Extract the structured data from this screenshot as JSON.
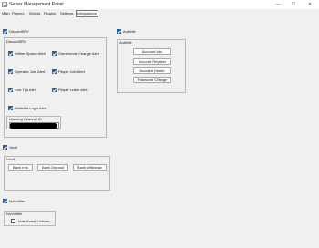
{
  "window": {
    "title": "Server Management Panel",
    "controls": {
      "minimize": "—",
      "maximize": "☐",
      "close": "✕"
    }
  },
  "menu": {
    "items": [
      "Main",
      "Players",
      "Worlds",
      "Plugins",
      "Settings",
      "Integrations"
    ],
    "active": "Integrations"
  },
  "discordsrv": {
    "enable_label": "DiscordSRV",
    "enabled": true,
    "group_title": "DiscordSRV",
    "options": [
      {
        "label": "Wither Spawn Alert",
        "checked": true
      },
      {
        "label": "Gamemode Change Alert",
        "checked": true
      },
      {
        "label": "Operator Join Alert",
        "checked": true
      },
      {
        "label": "Player Join Alert",
        "checked": true
      },
      {
        "label": "Low Tps Alert",
        "checked": true
      },
      {
        "label": "Player Leave Alert",
        "checked": true
      },
      {
        "label": "Whitelist Login Alert",
        "checked": true
      }
    ],
    "warning_channel_label": "Warning Channel ID"
  },
  "authme": {
    "enable_label": "AuthMe",
    "enabled": true,
    "group_title": "AuthMe",
    "buttons": [
      "Account Info",
      "Account Register",
      "Account Delete",
      "Password Change"
    ]
  },
  "vault": {
    "enable_label": "Vault",
    "enabled": true,
    "group_title": "Vault",
    "buttons": [
      "Bank Info",
      "Bank Deposit",
      "Bank Withdraw"
    ]
  },
  "nuvotifier": {
    "enable_label": "NuVotifier",
    "enabled": true,
    "group_title": "NuVotifier",
    "options": [
      {
        "label": "Vote Event Listener",
        "checked": false
      }
    ]
  }
}
